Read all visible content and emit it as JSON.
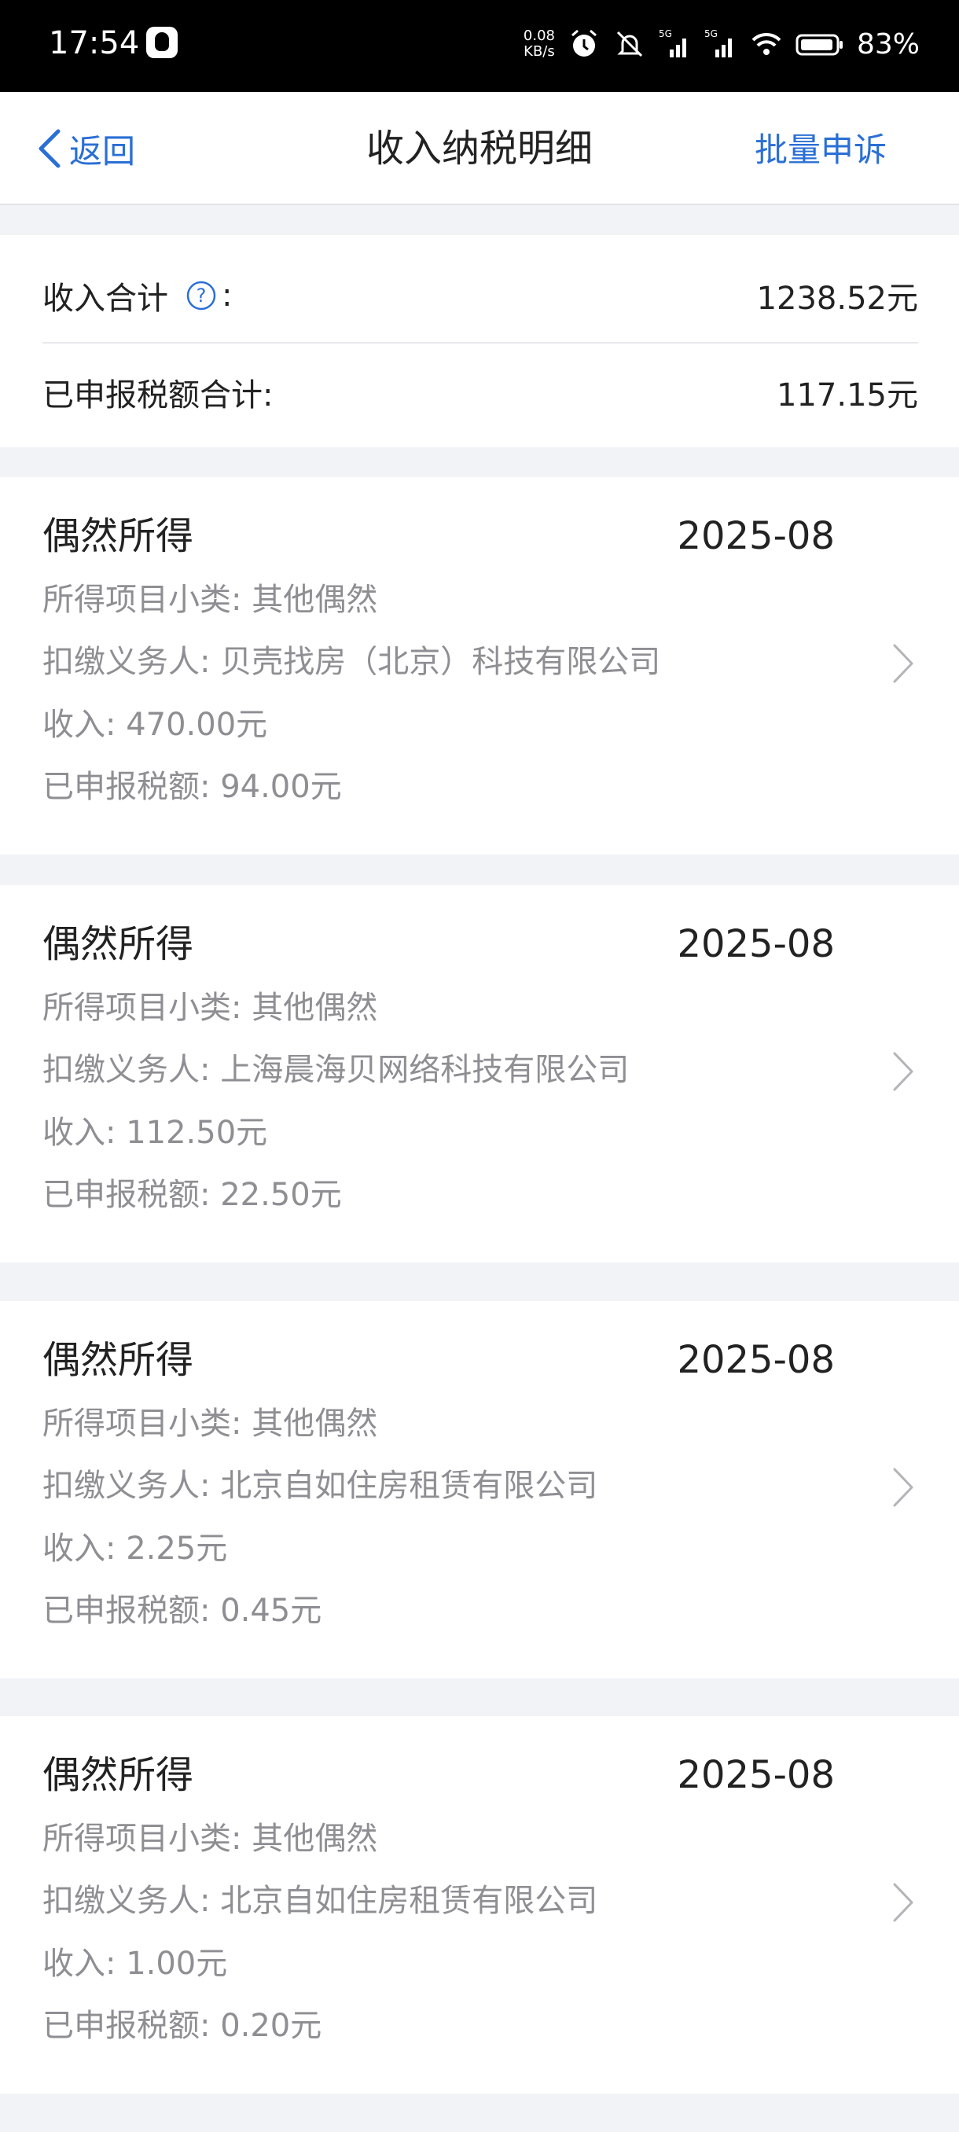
{
  "status_bar": {
    "time": "17:54",
    "net_speed_value": "0.08",
    "net_speed_unit": "KB/s",
    "signal_1": "5G",
    "signal_2": "5G",
    "battery": "83%"
  },
  "nav": {
    "back_label": "返回",
    "title": "收入纳税明细",
    "action_label": "批量申诉"
  },
  "summary": {
    "income_label": "收入合计",
    "income_colon": ":",
    "income_value": "1238.52元",
    "tax_label": "已申报税额合计:",
    "tax_value": "117.15元"
  },
  "records": [
    {
      "type": "偶然所得",
      "period": "2025-08",
      "subcategory": "所得项目小类: 其他偶然",
      "withholder": "扣缴义务人: 贝壳找房（北京）科技有限公司",
      "income": "收入: 470.00元",
      "tax": "已申报税额: 94.00元"
    },
    {
      "type": "偶然所得",
      "period": "2025-08",
      "subcategory": "所得项目小类: 其他偶然",
      "withholder": "扣缴义务人: 上海晨海贝网络科技有限公司",
      "income": "收入: 112.50元",
      "tax": "已申报税额: 22.50元"
    },
    {
      "type": "偶然所得",
      "period": "2025-08",
      "subcategory": "所得项目小类: 其他偶然",
      "withholder": "扣缴义务人: 北京自如住房租赁有限公司",
      "income": "收入: 2.25元",
      "tax": "已申报税额: 0.45元"
    },
    {
      "type": "偶然所得",
      "period": "2025-08",
      "subcategory": "所得项目小类: 其他偶然",
      "withholder": "扣缴义务人: 北京自如住房租赁有限公司",
      "income": "收入: 1.00元",
      "tax": "已申报税额: 0.20元"
    }
  ],
  "colors": {
    "accent": "#2a6fd6",
    "page_bg": "#f2f3f7",
    "secondary_text": "#8e8e93"
  }
}
